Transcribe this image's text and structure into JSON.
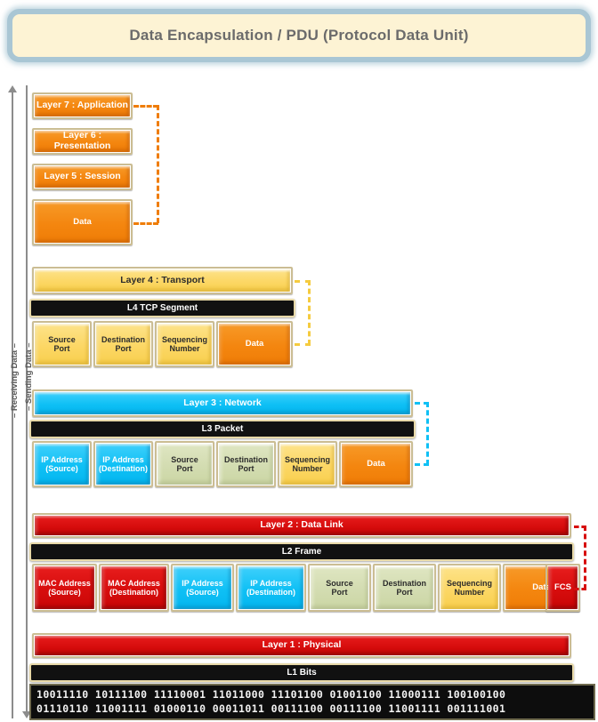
{
  "title": "Data Encapsulation / PDU (Protocol Data Unit)",
  "direction_labels": {
    "receiving": "– Receiving Data –",
    "sending": "– Sending Data –"
  },
  "colors": {
    "orange": "#f4860f",
    "yellow": "#fcd765",
    "cyan": "#0fc0f5",
    "red": "#d70d0d",
    "green": "#d3dcb1",
    "black": "#111111",
    "title_fill": "#fdf3d4",
    "title_border": "#a9c6d4",
    "box_border": "#cbbd93"
  },
  "upper_layers": {
    "layer7": "Layer 7 : Application",
    "layer6": "Layer 6 : Presentation",
    "layer5": "Layer 5 : Session",
    "data": "Data"
  },
  "layer4": {
    "header": "Layer 4 : Transport",
    "pdu": "L4 TCP Segment",
    "fields": [
      {
        "label": "Source\nPort",
        "line1": "Source",
        "line2": "Port",
        "color": "yellow"
      },
      {
        "label": "Destination\nPort",
        "line1": "Destination",
        "line2": "Port",
        "color": "yellow"
      },
      {
        "label": "Sequencing\nNumber",
        "line1": "Sequencing",
        "line2": "Number",
        "color": "yellow"
      },
      {
        "label": "Data",
        "line1": "Data",
        "line2": "",
        "color": "orange"
      }
    ]
  },
  "layer3": {
    "header": "Layer 3 : Network",
    "pdu": "L3 Packet",
    "fields": [
      {
        "line1": "IP Address",
        "line2": "(Source)",
        "color": "cyan"
      },
      {
        "line1": "IP Address",
        "line2": "(Destination)",
        "color": "cyan"
      },
      {
        "line1": "Source",
        "line2": "Port",
        "color": "green"
      },
      {
        "line1": "Destination",
        "line2": "Port",
        "color": "green"
      },
      {
        "line1": "Sequencing",
        "line2": "Number",
        "color": "yellow"
      },
      {
        "line1": "Data",
        "line2": "",
        "color": "orange"
      }
    ]
  },
  "layer2": {
    "header": "Layer 2 : Data Link",
    "pdu": "L2 Frame",
    "fields": [
      {
        "line1": "MAC Address",
        "line2": "(Source)",
        "color": "red"
      },
      {
        "line1": "MAC Address",
        "line2": "(Destination)",
        "color": "red"
      },
      {
        "line1": "IP Address",
        "line2": "(Source)",
        "color": "cyan"
      },
      {
        "line1": "IP Address",
        "line2": "(Destination)",
        "color": "cyan"
      },
      {
        "line1": "Source",
        "line2": "Port",
        "color": "green"
      },
      {
        "line1": "Destination",
        "line2": "Port",
        "color": "green"
      },
      {
        "line1": "Sequencing",
        "line2": "Number",
        "color": "yellow"
      },
      {
        "line1": "Data",
        "line2": "",
        "color": "orange"
      },
      {
        "line1": "FCS",
        "line2": "",
        "color": "red"
      }
    ]
  },
  "layer1": {
    "header": "Layer 1 : Physical",
    "pdu": "L1 Bits",
    "bits_row1": "10011110  10111100  11110001  11011000  11101100  01001100  11000111  100100100",
    "bits_row2": "01110110  11001111  01000110  00011011  00111100  00111100  11001111  001111001"
  }
}
